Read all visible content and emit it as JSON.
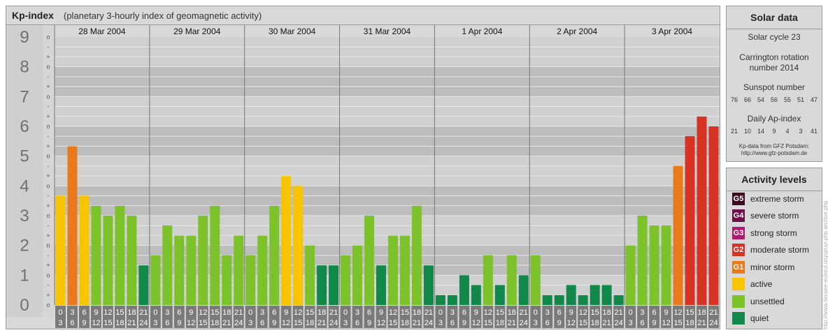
{
  "header": {
    "title": "Kp-index",
    "subtitle": "(planetary 3-hourly index of geomagnetic activity)"
  },
  "chart_data": {
    "type": "bar",
    "title": "Kp-index",
    "subtitle": "(planetary 3-hourly index of geomagnetic activity)",
    "y_ticks": [
      "0",
      "1",
      "2",
      "3",
      "4",
      "5",
      "6",
      "7",
      "8",
      "9"
    ],
    "y_minor_ticks": [
      "o",
      "+",
      "-"
    ],
    "ylim": [
      0,
      9
    ],
    "grid": true,
    "days": [
      "28 Mar 2004",
      "29 Mar 2004",
      "30 Mar 2004",
      "31 Mar 2004",
      "1 Apr 2004",
      "2 Apr 2004",
      "3 Apr 2004"
    ],
    "hour_ticks_top": [
      "0",
      "3",
      "6",
      "9",
      "12",
      "15",
      "18",
      "21"
    ],
    "hour_ticks_bottom": [
      "3",
      "6",
      "9",
      "12",
      "15",
      "18",
      "21",
      "24"
    ],
    "values": [
      [
        3.67,
        5.33,
        3.67,
        3.33,
        3.0,
        3.33,
        3.0,
        1.33
      ],
      [
        1.67,
        2.67,
        2.33,
        2.33,
        3.0,
        3.33,
        1.67,
        2.33
      ],
      [
        1.67,
        2.33,
        3.33,
        4.33,
        4.0,
        2.0,
        1.33,
        1.33
      ],
      [
        1.67,
        2.0,
        3.0,
        1.33,
        2.33,
        2.33,
        3.33,
        1.33
      ],
      [
        0.33,
        0.33,
        1.0,
        0.67,
        1.67,
        0.67,
        1.67,
        1.0
      ],
      [
        1.67,
        0.33,
        0.33,
        0.67,
        0.33,
        0.67,
        0.67,
        0.33
      ],
      [
        2.0,
        3.0,
        2.67,
        2.67,
        4.67,
        5.67,
        6.33,
        6.0
      ]
    ],
    "level_colors": {
      "quiet": "#11884a",
      "unsettled": "#7cc22a",
      "active": "#f8c400",
      "G1": "#e87a1c",
      "G2": "#d63325",
      "G3": "#b0196e",
      "G4": "#6c1148",
      "G5": "#3d0a24"
    }
  },
  "solar": {
    "title": "Solar data",
    "cycle": "Solar cycle 23",
    "carrington_1": "Carrington rotation",
    "carrington_2": "number 2014",
    "sunspot_title": "Sunspot number",
    "sunspot_values": [
      "76",
      "66",
      "54",
      "56",
      "55",
      "51",
      "47"
    ],
    "ap_title": "Daily Ap-index",
    "ap_values": [
      "21",
      "10",
      "14",
      "9",
      "4",
      "3",
      "41"
    ],
    "source_1": "Kp-data from GFZ Potsdam:",
    "source_2": "http://www.gfz-potsdam.de"
  },
  "legend": {
    "title": "Activity levels",
    "items": [
      {
        "badge": "G5",
        "label": "extreme storm",
        "color": "#3d0a24"
      },
      {
        "badge": "G4",
        "label": "severe storm",
        "color": "#6c1148"
      },
      {
        "badge": "G3",
        "label": "strong storm",
        "color": "#b0196e"
      },
      {
        "badge": "G2",
        "label": "moderate storm",
        "color": "#d63325"
      },
      {
        "badge": "G1",
        "label": "minor storm",
        "color": "#e87a1c"
      },
      {
        "badge": "",
        "label": "active",
        "color": "#f8c400"
      },
      {
        "badge": "",
        "label": "unsettled",
        "color": "#7cc22a"
      },
      {
        "badge": "",
        "label": "quiet",
        "color": "#11884a"
      }
    ]
  },
  "credit": "http://www.tieusee-eulerul.org/gruyr.php   archive.php"
}
